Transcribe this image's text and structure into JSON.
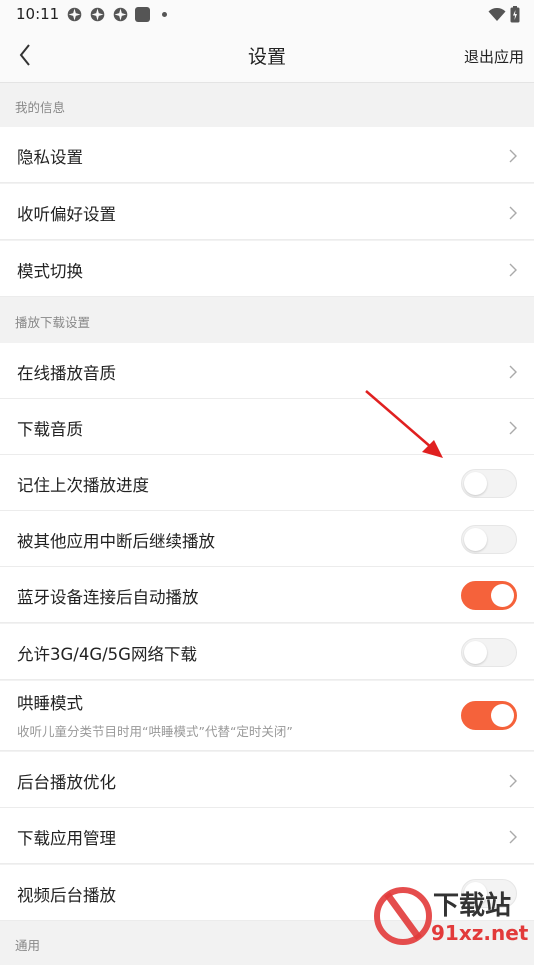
{
  "status_bar": {
    "time": "10:11"
  },
  "header": {
    "title": "设置",
    "exit_label": "退出应用"
  },
  "sections": {
    "my_info": "我的信息",
    "playback": "播放下载设置",
    "general": "通用"
  },
  "rows": {
    "privacy": "隐私设置",
    "listening_prefs": "收听偏好设置",
    "mode_switch": "模式切换",
    "online_quality": "在线播放音质",
    "download_quality": "下载音质",
    "remember_progress": "记住上次播放进度",
    "resume_after_interrupt": "被其他应用中断后继续播放",
    "bluetooth_autoplay": "蓝牙设备连接后自动播放",
    "allow_mobile_download": "允许3G/4G/5G网络下载",
    "sleep_mode": "哄睡模式",
    "sleep_mode_desc": "收听儿童分类节目时用“哄睡模式”代替“定时关闭”",
    "background_optimize": "后台播放优化",
    "download_manager": "下载应用管理",
    "video_background": "视频后台播放"
  },
  "toggles": {
    "remember_progress": false,
    "resume_after_interrupt": false,
    "bluetooth_autoplay": true,
    "allow_mobile_download": false,
    "sleep_mode": true,
    "video_background": false
  },
  "colors": {
    "accent": "#f5623b",
    "watermark_red": "#e23a3a"
  },
  "watermark": {
    "brand": "下载站",
    "domain": "91xz.net"
  },
  "icons": [
    "back-arrow-icon",
    "chevron-right-icon",
    "wifi-icon",
    "battery-icon",
    "annotation-arrow-icon"
  ]
}
